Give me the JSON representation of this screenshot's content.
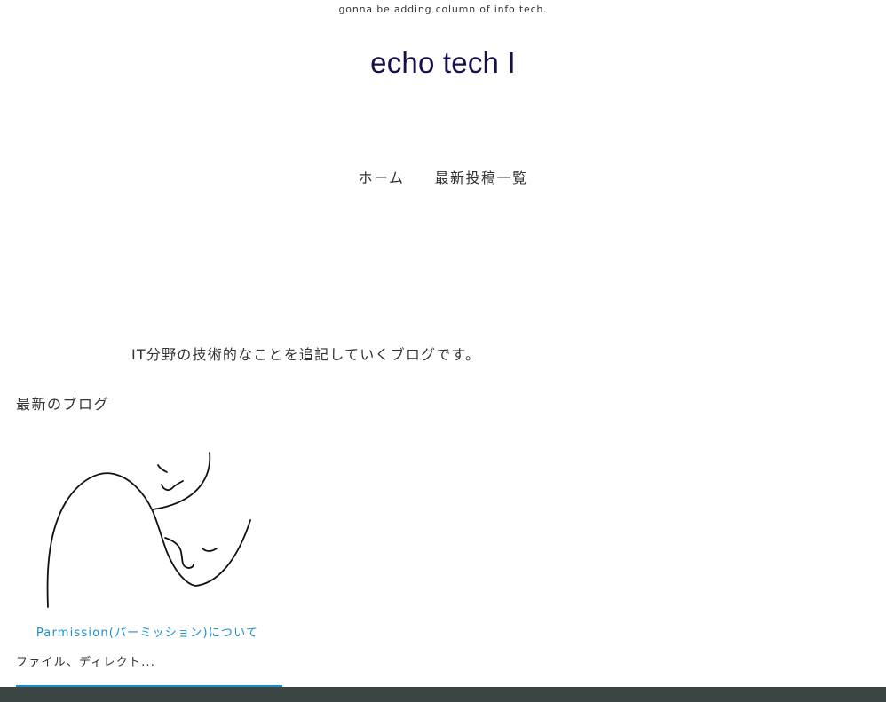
{
  "header": {
    "tagline": "gonna be adding column of info tech.",
    "site_title": "echo tech I"
  },
  "nav": {
    "items": [
      {
        "label": "ホーム"
      },
      {
        "label": "最新投稿一覧"
      }
    ]
  },
  "main": {
    "intro": "IT分野の技術的なことを追記していくブログです。",
    "section_heading": "最新のブログ",
    "posts": [
      {
        "title": "Parmission(パーミッション)について",
        "excerpt": "ファイル、ディレクト...",
        "image_icon": "line-drawing-embrace-illustration"
      }
    ]
  },
  "colors": {
    "title": "#1a0f4a",
    "link": "#1a8fcc",
    "text": "#333333",
    "footer": "#3a4442"
  }
}
